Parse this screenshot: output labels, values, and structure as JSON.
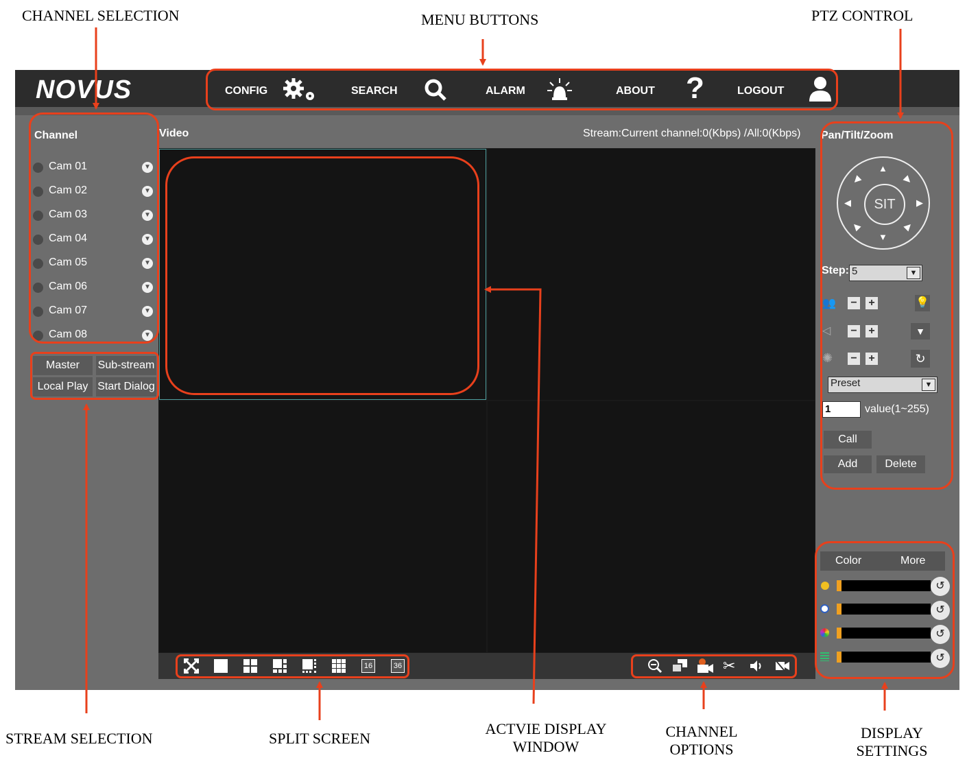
{
  "callouts": {
    "channel_selection": "CHANNEL SELECTION",
    "menu_buttons": "MENU BUTTONS",
    "ptz_control": "PTZ CONTROL",
    "stream_selection": "STREAM SELECTION",
    "split_screen": "SPLIT SCREEN",
    "active_display_line1": "ACTVIE DISPLAY",
    "active_display_line2": "WINDOW",
    "channel_options_line1": "CHANNEL",
    "channel_options_line2": "OPTIONS",
    "display_settings_line1": "DISPLAY",
    "display_settings_line2": "SETTINGS"
  },
  "header": {
    "logo_text": "NOVUS",
    "menu": [
      {
        "label": "CONFIG",
        "icon": "gears-icon"
      },
      {
        "label": "SEARCH",
        "icon": "search-icon"
      },
      {
        "label": "ALARM",
        "icon": "alarm-light-icon"
      },
      {
        "label": "ABOUT",
        "icon": "question-icon"
      },
      {
        "label": "LOGOUT",
        "icon": "user-icon"
      }
    ]
  },
  "sidebar": {
    "title": "Channel",
    "cameras": [
      "Cam 01",
      "Cam 02",
      "Cam 03",
      "Cam 04",
      "Cam 05",
      "Cam 06",
      "Cam 07",
      "Cam 08"
    ],
    "stream_buttons": [
      "Master",
      "Sub-stream",
      "Local Play",
      "Start Dialog"
    ]
  },
  "video": {
    "title": "Video",
    "stream_status": "Stream:Current channel:0(Kbps) /All:0(Kbps)",
    "split_labels": {
      "sixteen": "16",
      "thirtysix": "36"
    }
  },
  "ptz": {
    "title": "Pan/Tilt/Zoom",
    "center_label": "SIT",
    "step_label": "Step:",
    "step_value": "5",
    "preset_selected": "Preset",
    "preset_input": "1",
    "value_hint": "value(1~255)",
    "buttons": {
      "call": "Call",
      "add": "Add",
      "delete": "Delete"
    }
  },
  "display": {
    "tabs": [
      "Color",
      "More"
    ]
  },
  "colors": {
    "accent_red": "#e8401c",
    "panel_gray": "#6d6d6d",
    "topbar": "#2c2c2c",
    "slider_knob": "#f0a020"
  }
}
